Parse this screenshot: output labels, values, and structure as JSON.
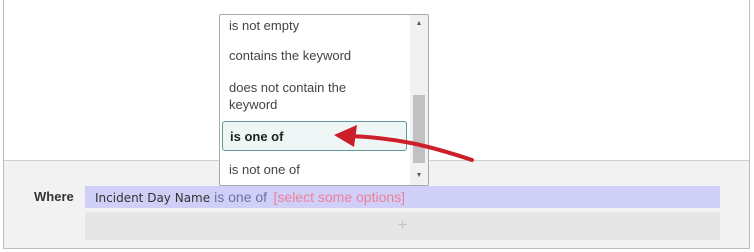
{
  "dropdown": {
    "options": [
      {
        "label": "is not empty"
      },
      {
        "label": "contains the keyword"
      },
      {
        "label": "does not contain the keyword"
      },
      {
        "label": "is one of",
        "selected": true
      },
      {
        "label": "is not one of"
      }
    ]
  },
  "condition": {
    "where_label": "Where",
    "field": "Incident Day Name",
    "operator": "is one of",
    "options_placeholder": "[select some options]",
    "add_label": "+"
  },
  "colors": {
    "arrow": "#cc1f2a",
    "condition_row": "#cfcff7",
    "placeholder": "#f07f9a"
  }
}
